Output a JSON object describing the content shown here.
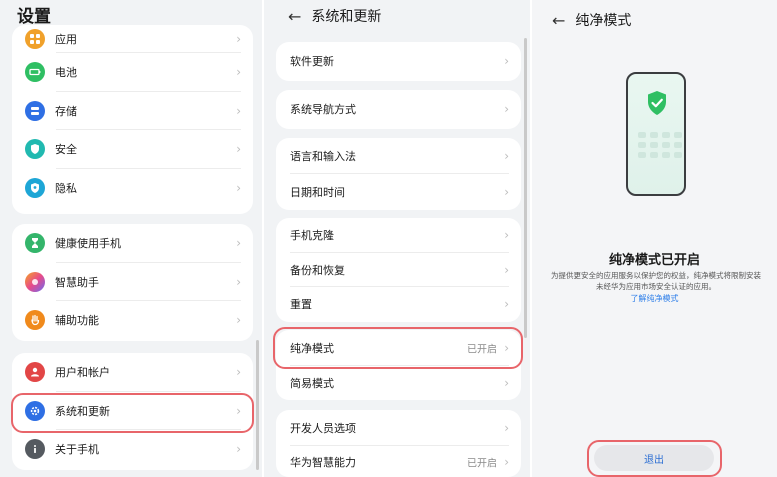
{
  "screen1": {
    "title": "设置",
    "group1": [
      {
        "label": "应用",
        "icon": "apps-icon",
        "color": "#f0a12b"
      },
      {
        "label": "电池",
        "icon": "battery-icon",
        "color": "#2fbf63"
      },
      {
        "label": "存储",
        "icon": "storage-icon",
        "color": "#2f6fe4"
      },
      {
        "label": "安全",
        "icon": "shield-icon",
        "color": "#21b9b0"
      },
      {
        "label": "隐私",
        "icon": "privacy-icon",
        "color": "#1ea6d6"
      }
    ],
    "group2": [
      {
        "label": "健康使用手机",
        "icon": "hourglass-icon",
        "color": "#34b56b"
      },
      {
        "label": "智慧助手",
        "icon": "assistant-icon",
        "color": "#7b72f0"
      },
      {
        "label": "辅助功能",
        "icon": "accessibility-icon",
        "color": "#f08a1c"
      }
    ],
    "group3": [
      {
        "label": "用户和帐户",
        "icon": "user-icon",
        "color": "#e24646"
      },
      {
        "label": "系统和更新",
        "icon": "system-update-icon",
        "color": "#2f6fe4"
      },
      {
        "label": "关于手机",
        "icon": "info-icon",
        "color": "#555a60"
      }
    ]
  },
  "screen2": {
    "title": "系统和更新",
    "groups": [
      [
        {
          "label": "软件更新",
          "value": ""
        }
      ],
      [
        {
          "label": "系统导航方式",
          "value": ""
        }
      ],
      [
        {
          "label": "语言和输入法",
          "value": ""
        },
        {
          "label": "日期和时间",
          "value": ""
        }
      ],
      [
        {
          "label": "手机克隆",
          "value": ""
        },
        {
          "label": "备份和恢复",
          "value": ""
        },
        {
          "label": "重置",
          "value": ""
        }
      ],
      [
        {
          "label": "纯净模式",
          "value": "已开启"
        },
        {
          "label": "简易模式",
          "value": ""
        }
      ],
      [
        {
          "label": "开发人员选项",
          "value": ""
        },
        {
          "label": "华为智慧能力",
          "value": "已开启"
        }
      ]
    ]
  },
  "screen3": {
    "title": "纯净模式",
    "heading": "纯净模式已开启",
    "description": "为提供更安全的应用服务以保护您的权益，纯净模式将限制安装未经华为应用市场安全认证的应用。",
    "link": "了解纯净模式",
    "exit_label": "退出"
  },
  "colors": {
    "highlight": "#e8656a",
    "link": "#2b7de9",
    "shield": "#2fbf63"
  }
}
